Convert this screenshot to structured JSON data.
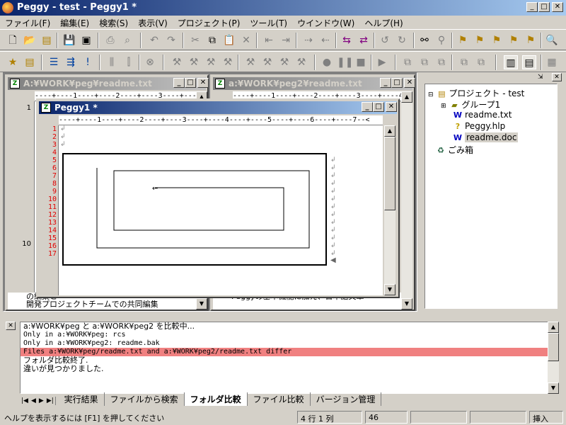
{
  "window": {
    "title": "Peggy - test - Peggy1 *"
  },
  "menu": [
    "ファイル(F)",
    "編集(E)",
    "検索(S)",
    "表示(V)",
    "プロジェクト(P)",
    "ツール(T)",
    "ウインドウ(W)",
    "ヘルプ(H)"
  ],
  "child_windows": {
    "left": {
      "title": "A:¥WORK¥peg¥readme.txt",
      "line_number": "1",
      "line_number_2": "10",
      "bottom_text": "の編集と",
      "bottom_text_2": "開発プロジェクトチームでの共同編集"
    },
    "right": {
      "title": "a:¥WORK¥peg2¥readme.txt",
      "bottom_text": "Peggyの基本機能に加え、日本語文章"
    },
    "active": {
      "title": "Peggy1 *",
      "lines": [
        "1",
        "2",
        "3",
        "4",
        "5",
        "6",
        "7",
        "8",
        "9",
        "10",
        "11",
        "12",
        "13",
        "14",
        "15",
        "16",
        "17"
      ]
    }
  },
  "ruler_text": "----+----1----+----2----+----3----+----4----+----5----+----6----+----7--<",
  "project": {
    "root": "プロジェクト - test",
    "items": [
      {
        "label": "グループ1",
        "icon": "folder-group-icon"
      },
      {
        "label": "readme.txt",
        "icon": "text-doc-icon"
      },
      {
        "label": "Peggy.hlp",
        "icon": "help-file-icon"
      },
      {
        "label": "readme.doc",
        "icon": "word-doc-icon",
        "selected": true
      }
    ],
    "trash": "ごみ箱"
  },
  "output": {
    "lines": [
      "a:¥WORK¥peg と a:¥WORK¥peg2 を比較中...",
      "Only in a:¥WORK¥peg: rcs",
      "Only in a:¥WORK¥peg2: readme.bak",
      "Files a:¥WORK¥peg/readme.txt and a:¥WORK¥peg2/readme.txt differ",
      "フォルダ比較終了.",
      "違いが見つかりました."
    ],
    "highlight_color": "#f08080",
    "tabs": [
      "実行結果",
      "ファイルから検索",
      "フォルダ比較",
      "ファイル比較",
      "バージョン管理"
    ],
    "active_tab": "フォルダ比較"
  },
  "status": {
    "hint": "ヘルプを表示するには [F1] を押してください",
    "position": "4 行 1 列",
    "count": "46",
    "mode": "挿入"
  }
}
